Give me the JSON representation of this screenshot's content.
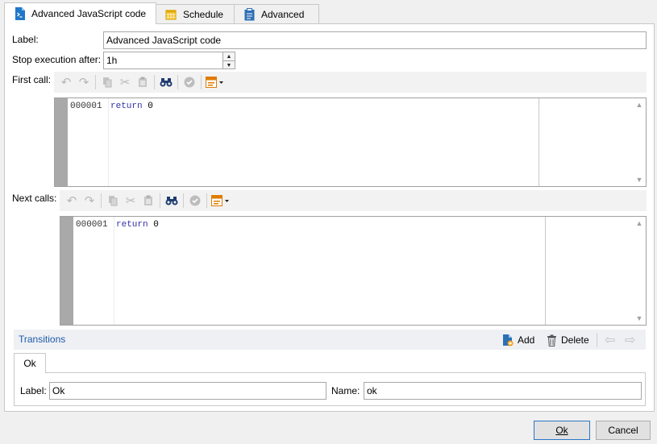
{
  "tabs": [
    {
      "label": "Advanced JavaScript code",
      "icon": "script-icon",
      "active": true
    },
    {
      "label": "Schedule",
      "icon": "calendar-icon",
      "active": false
    },
    {
      "label": "Advanced",
      "icon": "clipboard-icon",
      "active": false
    }
  ],
  "form": {
    "label_caption": "Label:",
    "label_value": "Advanced JavaScript code",
    "stop_caption": "Stop execution after:",
    "stop_value": "1h"
  },
  "first_call": {
    "caption": "First call:",
    "line_number": "000001",
    "code_keyword": "return",
    "code_value": "0"
  },
  "next_calls": {
    "caption": "Next calls:",
    "line_number": "000001",
    "code_keyword": "return",
    "code_value": "0"
  },
  "transitions": {
    "title": "Transitions",
    "add_label": "Add",
    "delete_label": "Delete",
    "tab_label": "Ok",
    "label_caption": "Label:",
    "label_value": "Ok",
    "name_caption": "Name:",
    "name_value": "ok"
  },
  "buttons": {
    "ok_label": "Ok",
    "cancel_label": "Cancel"
  },
  "colors": {
    "accent": "#1e5aa8",
    "editor_gutter": "#a9a9a9",
    "keyword": "#3333aa"
  }
}
